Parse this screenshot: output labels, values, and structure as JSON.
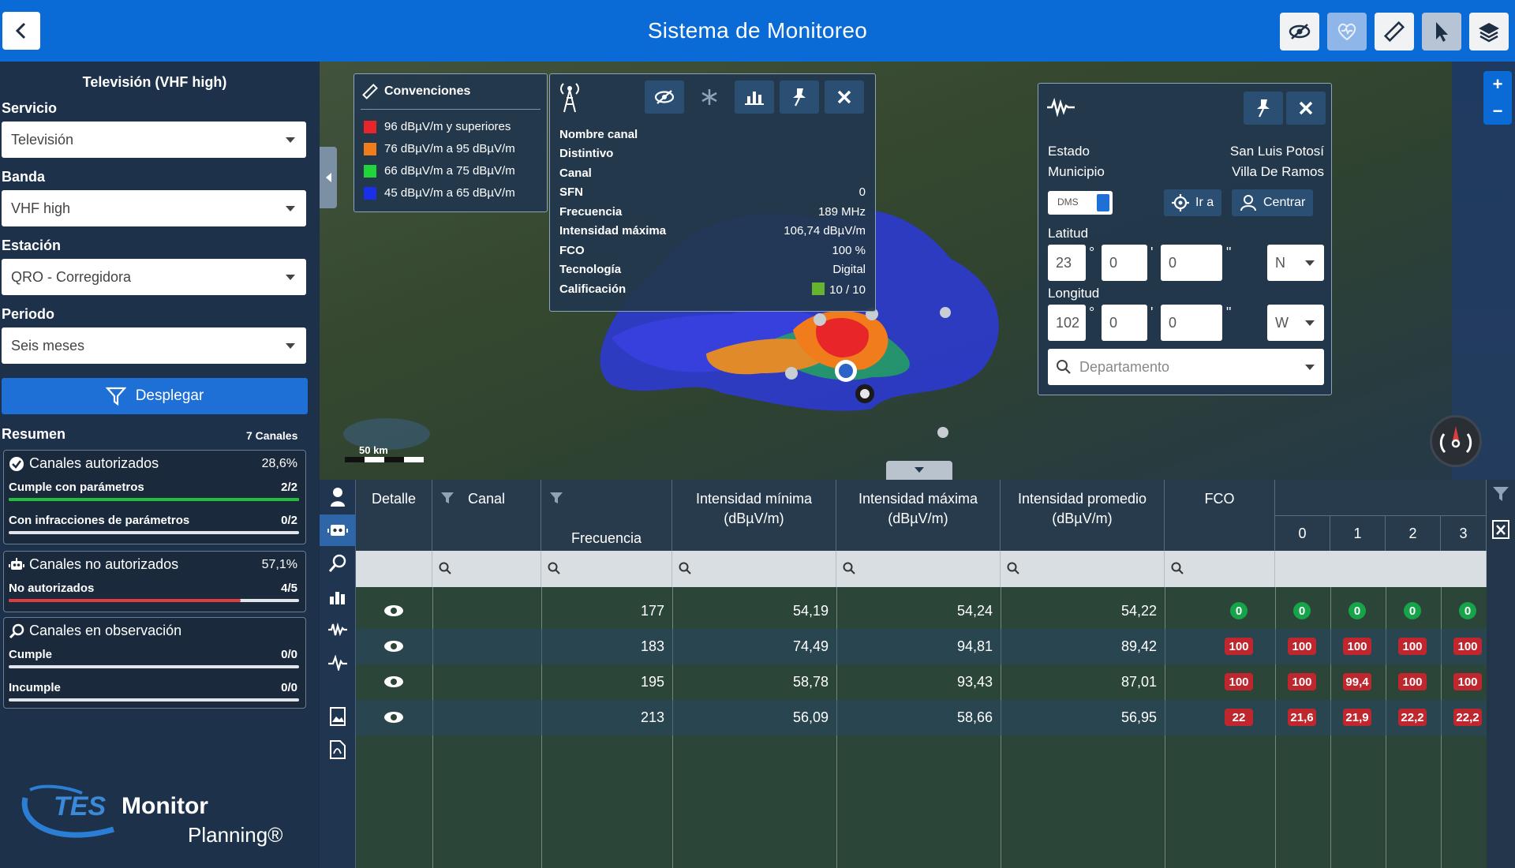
{
  "app": {
    "title": "Sistema de Monitoreo"
  },
  "sidebar": {
    "title": "Televisión (VHF high)",
    "servicio": {
      "label": "Servicio",
      "value": "Televisión"
    },
    "banda": {
      "label": "Banda",
      "value": "VHF high"
    },
    "estacion": {
      "label": "Estación",
      "value": "QRO - Corregidora"
    },
    "periodo": {
      "label": "Periodo",
      "value": "Seis meses"
    },
    "deploy_label": "Desplegar",
    "summary": {
      "title": "Resumen",
      "count": "7 Canales",
      "authorized": {
        "title": "Canales autorizados",
        "pct": "28,6%",
        "rows": [
          {
            "label": "Cumple con parámetros",
            "value": "2/2",
            "fraction": 1.0
          },
          {
            "label": "Con infracciones de parámetros",
            "value": "0/2",
            "fraction": 0.0
          }
        ]
      },
      "unauthorized": {
        "title": "Canales no autorizados",
        "pct": "57,1%",
        "rows": [
          {
            "label": "No autorizados",
            "value": "4/5",
            "fraction": 0.8
          }
        ]
      },
      "observation": {
        "title": "Canales en observación",
        "rows": [
          {
            "label": "Cumple",
            "value": "0/0",
            "fraction": 0.0
          },
          {
            "label": "Incumple",
            "value": "0/0",
            "fraction": 0.0
          }
        ]
      }
    },
    "logo": {
      "tes": "TES",
      "monitor": "Monitor",
      "planning": "Planning®"
    }
  },
  "legend": {
    "title": "Convenciones",
    "items": [
      {
        "label": "96 dBµV/m y superiores",
        "color": "#e8262a"
      },
      {
        "label": "76 dBµV/m a 95 dBµV/m",
        "color": "#f07c1c"
      },
      {
        "label": "66 dBµV/m a 75 dBµV/m",
        "color": "#21d43a"
      },
      {
        "label": "45 dBµV/m a 65 dBµV/m",
        "color": "#1a2fe8"
      }
    ]
  },
  "station": {
    "fields": [
      {
        "key": "Nombre canal",
        "value": ""
      },
      {
        "key": "Distintivo",
        "value": ""
      },
      {
        "key": "Canal",
        "value": ""
      },
      {
        "key": "SFN",
        "value": "0"
      },
      {
        "key": "Frecuencia",
        "value": "189 MHz"
      },
      {
        "key": "Intensidad máxima",
        "value": "106,74 dBµV/m"
      },
      {
        "key": "FCO",
        "value": "100 %"
      },
      {
        "key": "Tecnología",
        "value": "Digital"
      },
      {
        "key": "Calificación",
        "value": "10 / 10"
      }
    ],
    "rating_color": "#65b32e"
  },
  "locate": {
    "estado": {
      "label": "Estado",
      "value": "San Luis Potosí"
    },
    "municipio": {
      "label": "Municipio",
      "value": "Villa De Ramos"
    },
    "dms_label": "DMS",
    "goto_label": "Ir a",
    "center_label": "Centrar",
    "latitude": {
      "label": "Latitud",
      "deg": "23",
      "min": "0",
      "sec": "0",
      "hemi": "N"
    },
    "longitude": {
      "label": "Longitud",
      "deg": "102",
      "min": "0",
      "sec": "0",
      "hemi": "W"
    },
    "symbols": {
      "deg": "°",
      "min": "'",
      "sec": "\""
    },
    "dept_placeholder": "Departamento"
  },
  "map": {
    "scale_label": "50 km"
  },
  "table": {
    "headers": {
      "detalle": "Detalle",
      "canal": "Canal",
      "frecuencia": "Frecuencia\n(MHz)",
      "int_min": "Intensidad mínima\n(dBµV/m)",
      "int_max": "Intensidad máxima\n(dBµV/m)",
      "int_prom": "Intensidad promedio\n(dBµV/m)",
      "fco": "FCO",
      "days": [
        "0",
        "1",
        "2",
        "3"
      ]
    },
    "rows": [
      {
        "canal": "",
        "frecuencia": "177",
        "int_min": "54,19",
        "int_max": "54,24",
        "int_prom": "54,22",
        "fco": "0",
        "days": [
          "0",
          "0",
          "0",
          "0"
        ],
        "status": "ok"
      },
      {
        "canal": "",
        "frecuencia": "183",
        "int_min": "74,49",
        "int_max": "94,81",
        "int_prom": "89,42",
        "fco": "100",
        "days": [
          "100",
          "100",
          "100",
          "100"
        ],
        "status": "bad"
      },
      {
        "canal": "",
        "frecuencia": "195",
        "int_min": "58,78",
        "int_max": "93,43",
        "int_prom": "87,01",
        "fco": "100",
        "days": [
          "100",
          "99,4",
          "100",
          "100"
        ],
        "status": "bad"
      },
      {
        "canal": "",
        "frecuencia": "213",
        "int_min": "56,09",
        "int_max": "58,66",
        "int_prom": "56,95",
        "fco": "22",
        "days": [
          "21,6",
          "21,9",
          "22,2",
          "22,2"
        ],
        "status": "bad"
      }
    ]
  }
}
